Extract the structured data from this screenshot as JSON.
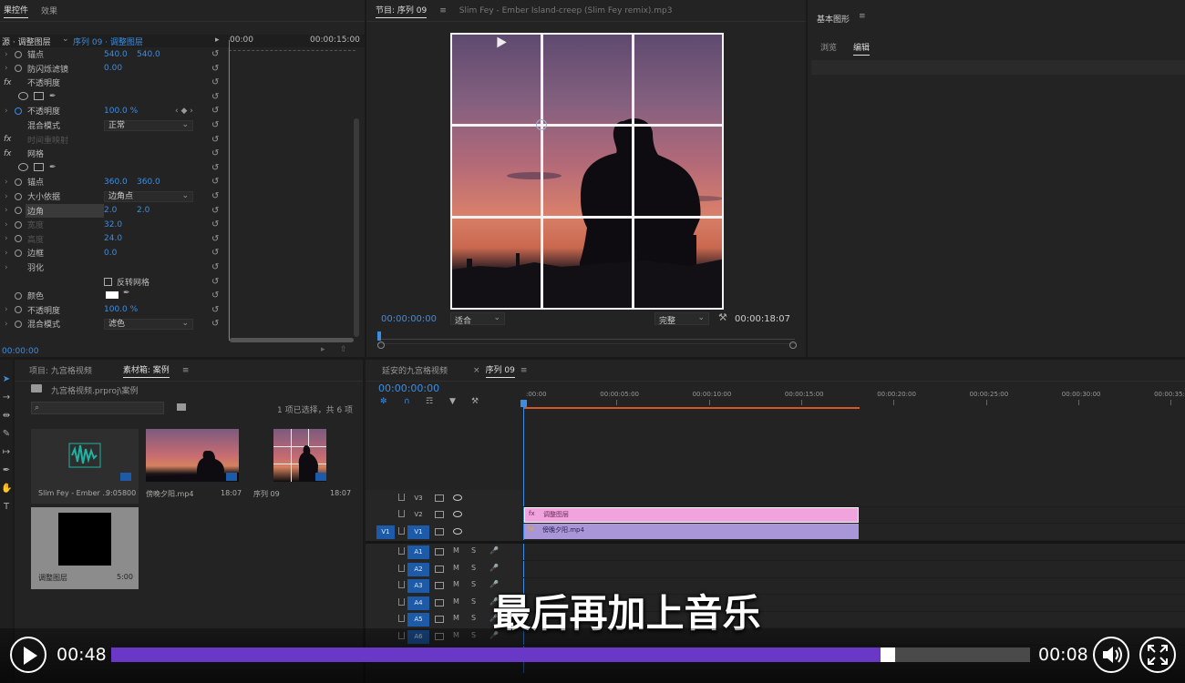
{
  "effects_panel": {
    "tabs": [
      "果控件",
      "效果"
    ],
    "source": "源 · 调整图层",
    "sequence": "序列 09 · 调整图层",
    "time_start": "00:00",
    "time_end": "00:00:15:00",
    "current_time": "00:00:00",
    "rows": [
      {
        "label": "锚点",
        "v1": "540.0",
        "v2": "540.0",
        "sw": true,
        "arrow": true
      },
      {
        "label": "防闪烁滤镜",
        "v1": "0.00",
        "sw": true,
        "arrow": true
      },
      {
        "label": "不透明度",
        "fx": true,
        "reset": true
      },
      {
        "shapes": true
      },
      {
        "label": "不透明度",
        "v1": "100.0 %",
        "sw": true,
        "arrow": true,
        "blue": true,
        "kf": true
      },
      {
        "label": "混合模式",
        "dd": "正常"
      },
      {
        "label": "时间重映射",
        "fx": true,
        "dim": true
      },
      {
        "label": "网格",
        "fx": true,
        "reset": true
      },
      {
        "shapes": true
      },
      {
        "label": "锚点",
        "v1": "360.0",
        "v2": "360.0",
        "sw": true,
        "arrow": true
      },
      {
        "label": "大小依据",
        "dd": "边角点",
        "sw": true,
        "arrow": true
      },
      {
        "label": "边角",
        "v1": "2.0",
        "v2": "2.0",
        "sw": true,
        "arrow": true,
        "hl": true
      },
      {
        "label": "宽度",
        "v1": "32.0",
        "sw": true,
        "arrow": true,
        "dim": true
      },
      {
        "label": "高度",
        "v1": "24.0",
        "sw": true,
        "arrow": true,
        "dim": true
      },
      {
        "label": "边框",
        "v1": "0.0",
        "sw": true,
        "arrow": true
      },
      {
        "label": "羽化",
        "arrow": true
      },
      {
        "check": "反转网格"
      },
      {
        "label": "颜色",
        "sw": true,
        "color": true
      },
      {
        "label": "不透明度",
        "v1": "100.0 %",
        "sw": true,
        "arrow": true
      },
      {
        "label": "混合模式",
        "dd": "滤色",
        "sw": true,
        "arrow": true
      }
    ]
  },
  "program": {
    "tab": "节目: 序列 09",
    "file": "Slim Fey - Ember Island-creep (Slim Fey remix).mp3",
    "timecode": "00:00:00:00",
    "fit": "适合",
    "quality": "完整",
    "duration": "00:00:18:07"
  },
  "essential": {
    "title": "基本图形",
    "tabs": [
      "浏览",
      "编辑"
    ]
  },
  "project": {
    "tabs": [
      "项目: 九宫格视频",
      "素材箱: 案例"
    ],
    "path": "九宫格视频.prproj\\案例",
    "status": "1 项已选择，共 6 项",
    "items": [
      {
        "name": "Slim Fey - Ember ...",
        "dur": "9:05800"
      },
      {
        "name": "傍晚夕阳.mp4",
        "dur": "18:07"
      },
      {
        "name": "序列 09",
        "dur": "18:07"
      },
      {
        "name": "调整图层",
        "dur": "5:00"
      }
    ]
  },
  "timeline": {
    "tabs": [
      "延安的九宫格视频",
      "序列 09"
    ],
    "timecode": "00:00:00:00",
    "ruler": [
      ":00:00",
      "00:00:05:00",
      "00:00:10:00",
      "00:00:15:00",
      "00:00:20:00",
      "00:00:25:00",
      "00:00:30:00",
      "00:00:35:00"
    ],
    "video_tracks": [
      "V3",
      "V2",
      "V1"
    ],
    "audio_tracks": [
      "A1",
      "A2",
      "A3",
      "A4",
      "A5",
      "A6"
    ],
    "source_v": "V1",
    "clip_adj": "调整图层",
    "clip_video": "傍晚夕阳.mp4",
    "mute": "M",
    "solo": "S"
  },
  "subtitle": "最后再加上音乐",
  "player": {
    "current": "00:48",
    "remaining": "00:08",
    "progress": 0.845
  }
}
